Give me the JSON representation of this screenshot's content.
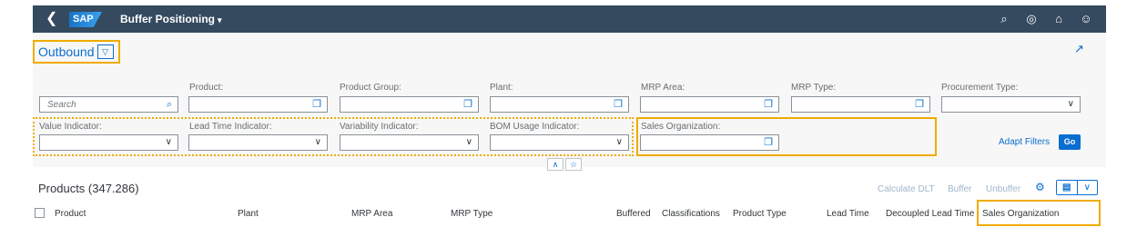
{
  "shell": {
    "back_icon": "back-icon",
    "logo": "SAP",
    "title": "Buffer Positioning",
    "title_caret": "▾",
    "icons": [
      "search-icon",
      "copilot-icon",
      "notifications-icon",
      "user-icon"
    ]
  },
  "variant": {
    "title": "Outbound",
    "dropdown_glyph": "▽"
  },
  "filters": {
    "search": {
      "placeholder": "Search"
    },
    "product": {
      "label": "Product:"
    },
    "product_group": {
      "label": "Product Group:"
    },
    "plant": {
      "label": "Plant:"
    },
    "mrp_area": {
      "label": "MRP Area:"
    },
    "mrp_type": {
      "label": "MRP Type:"
    },
    "procurement_type": {
      "label": "Procurement Type:"
    },
    "value_indicator": {
      "label": "Value Indicator:"
    },
    "lead_time_indicator": {
      "label": "Lead Time Indicator:"
    },
    "variability_indicator": {
      "label": "Variability Indicator:"
    },
    "bom_usage_indicator": {
      "label": "BOM Usage Indicator:"
    },
    "sales_organization": {
      "label": "Sales Organization:"
    },
    "adapt_filters": "Adapt Filters",
    "go": "Go"
  },
  "table": {
    "title": "Products (347.286)",
    "toolbar": {
      "calculate_dlt": "Calculate DLT",
      "buffer": "Buffer",
      "unbuffer": "Unbuffer"
    },
    "columns": [
      "Product",
      "Plant",
      "MRP Area",
      "MRP Type",
      "Buffered",
      "Classifications",
      "Product Type",
      "Lead Time",
      "Decoupled Lead Time",
      "Sales Organization"
    ]
  },
  "colors": {
    "shell": "#354a5f",
    "accent": "#0a6ed1",
    "highlight": "#f0ab00"
  }
}
